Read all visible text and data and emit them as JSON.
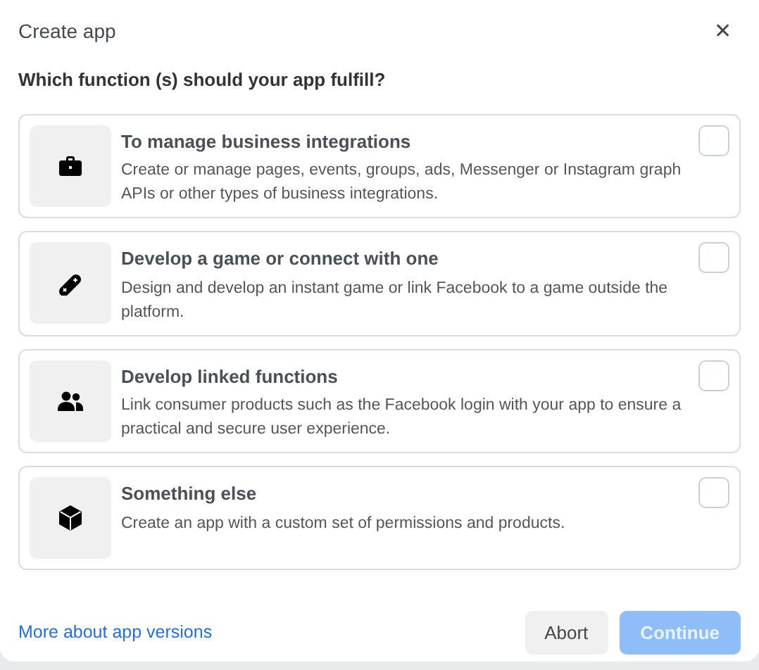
{
  "dialog": {
    "title": "Create app",
    "close": "✕"
  },
  "question": "Which function (s) should your app fulfill?",
  "options": [
    {
      "kind": "briefcase",
      "title": "To manage business integrations",
      "description": "Create or manage pages, events, groups, ads, Messenger or Instagram graph APIs or other types of business integrations.",
      "checked": false
    },
    {
      "kind": "gamepad",
      "title": "Develop a game or connect with one",
      "description": "Design and develop an instant game or link Facebook to a game outside the platform.",
      "checked": false
    },
    {
      "kind": "people",
      "title": "Develop linked functions",
      "description": "Link consumer products such as the Facebook login with your app to ensure a practical and secure user experience.",
      "checked": false
    },
    {
      "kind": "cube",
      "title": "Something else",
      "description": "Create an app with a custom set of permissions and products.",
      "checked": false
    }
  ],
  "footer": {
    "link": "More about app versions",
    "buttons": [
      {
        "label": "Abort",
        "kind": "secondary",
        "disabled": false
      },
      {
        "label": "Continue",
        "kind": "primary",
        "disabled": true
      }
    ]
  }
}
